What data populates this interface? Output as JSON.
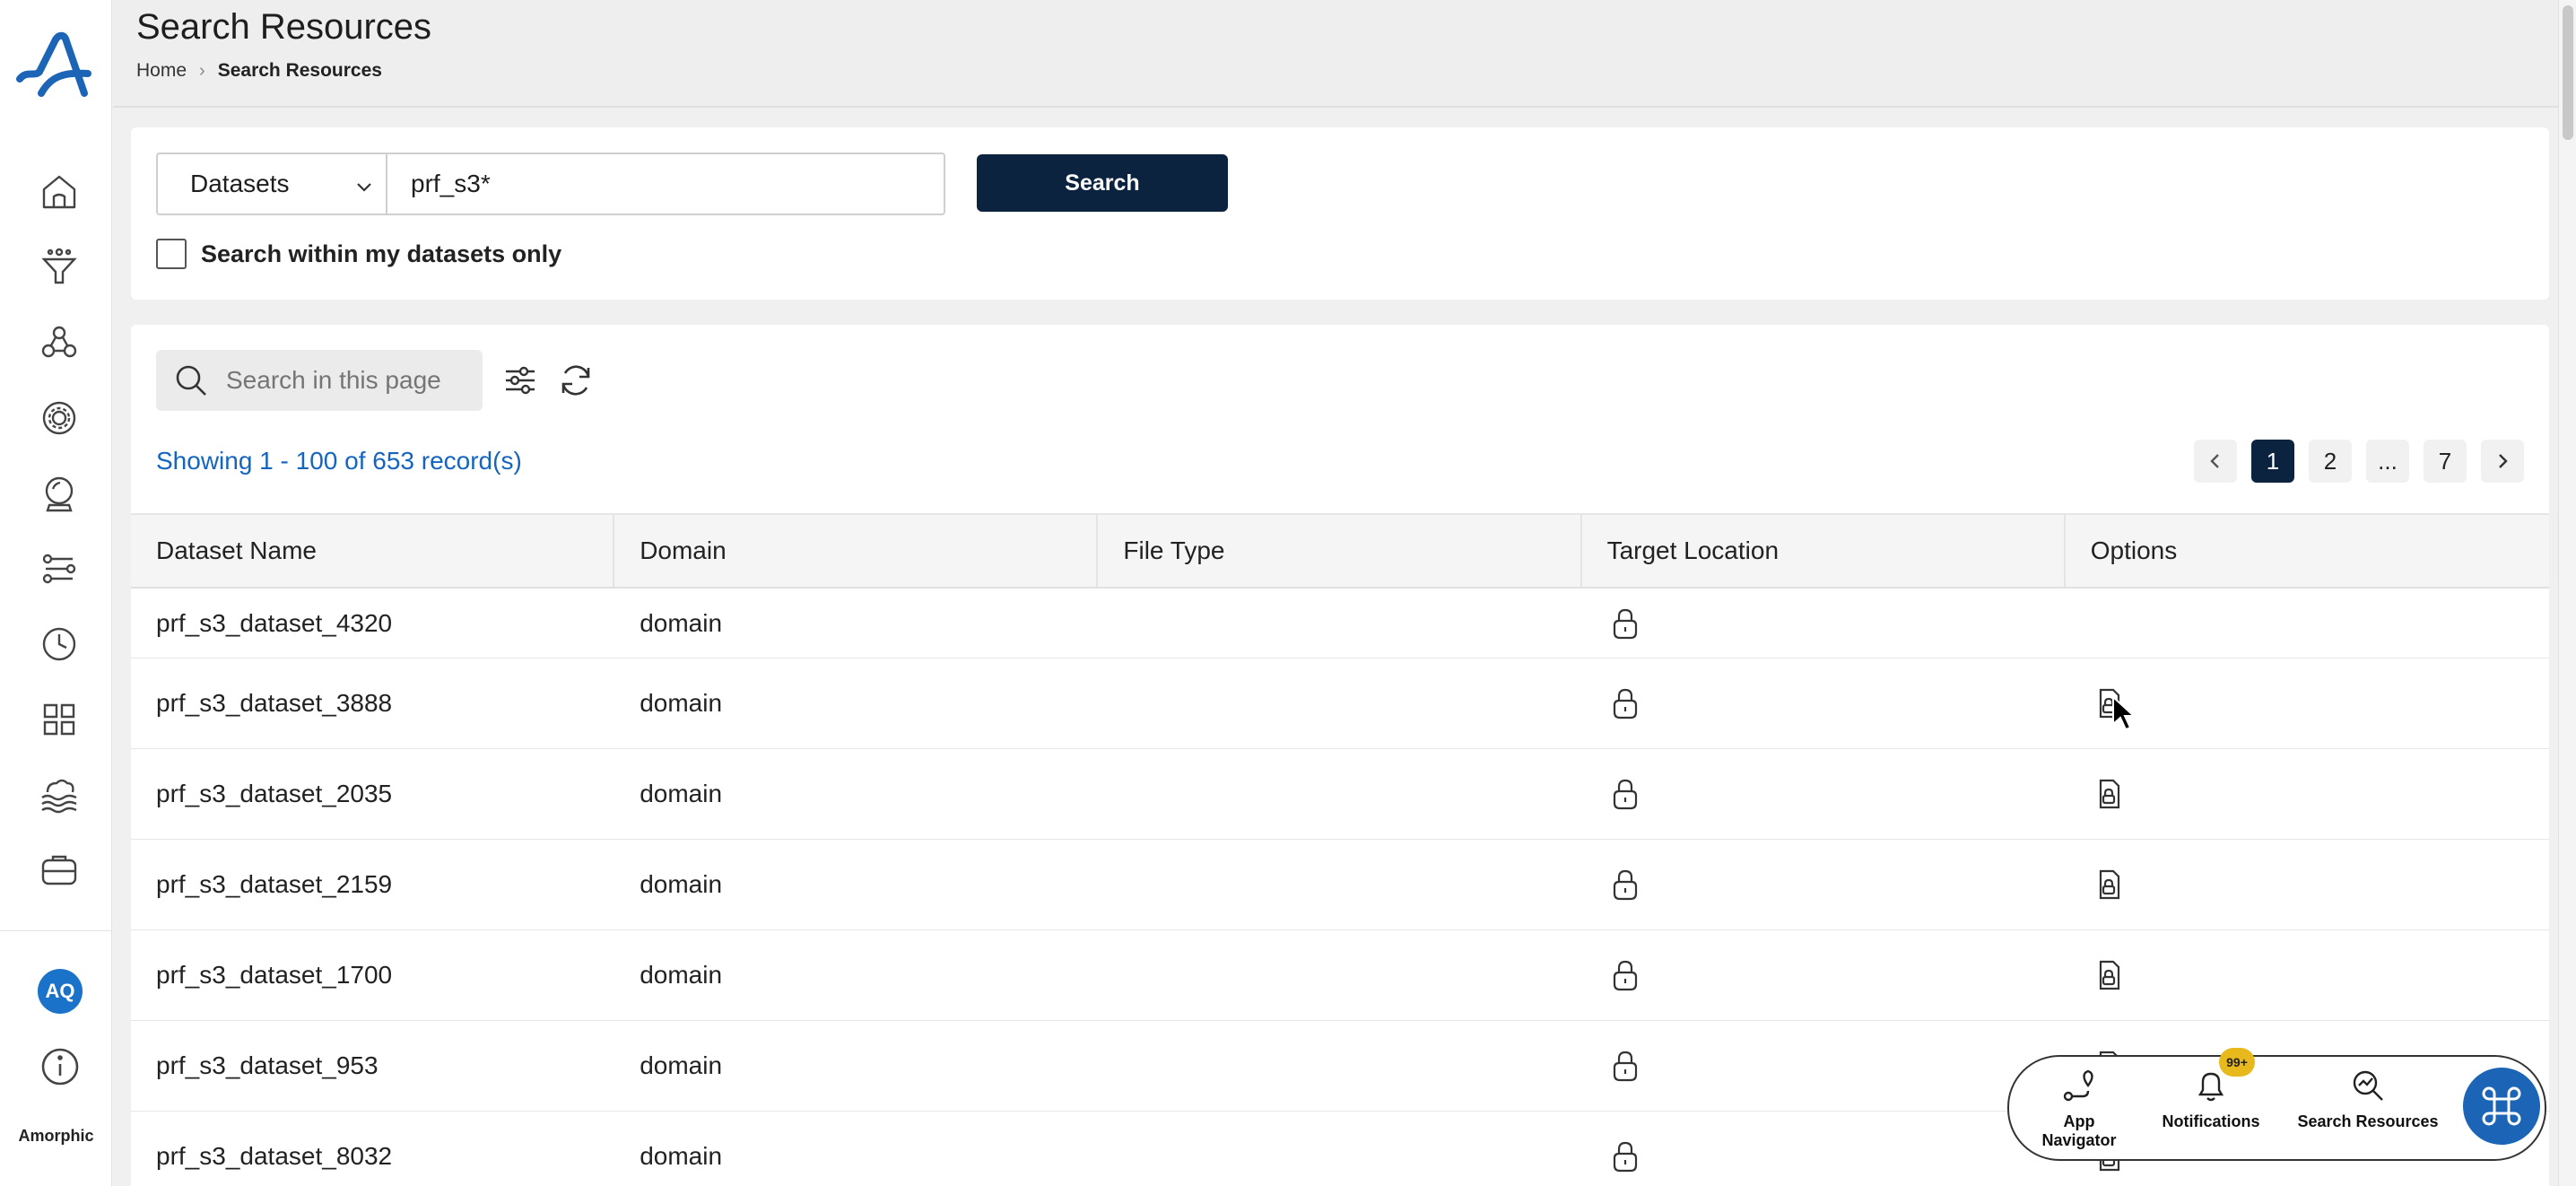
{
  "app": {
    "brand": "Amorphic",
    "user_initials": "AQ"
  },
  "header": {
    "title": "Search Resources",
    "breadcrumb": [
      "Home",
      "Search Resources"
    ]
  },
  "search": {
    "type_selected": "Datasets",
    "query": "prf_s3*",
    "button_label": "Search",
    "my_datasets_only_label": "Search within my datasets only",
    "my_datasets_only_checked": false
  },
  "results": {
    "page_search_placeholder": "Search in this page",
    "record_count_text": "Showing 1 - 100 of 653 record(s)",
    "pagination": {
      "pages": [
        "1",
        "2",
        "...",
        "7"
      ],
      "current": "1"
    },
    "columns": [
      "Dataset Name",
      "Domain",
      "File Type",
      "Target Location",
      "Options"
    ],
    "rows": [
      {
        "name": "prf_s3_dataset_4320",
        "domain": "domain",
        "file_type": "",
        "target_icon": "lock-icon",
        "has_option": false
      },
      {
        "name": "prf_s3_dataset_3888",
        "domain": "domain",
        "file_type": "",
        "target_icon": "lock-icon",
        "has_option": true
      },
      {
        "name": "prf_s3_dataset_2035",
        "domain": "domain",
        "file_type": "",
        "target_icon": "lock-icon",
        "has_option": true
      },
      {
        "name": "prf_s3_dataset_2159",
        "domain": "domain",
        "file_type": "",
        "target_icon": "lock-icon",
        "has_option": true
      },
      {
        "name": "prf_s3_dataset_1700",
        "domain": "domain",
        "file_type": "",
        "target_icon": "lock-icon",
        "has_option": true
      },
      {
        "name": "prf_s3_dataset_953",
        "domain": "domain",
        "file_type": "",
        "target_icon": "lock-icon",
        "has_option": true
      },
      {
        "name": "prf_s3_dataset_8032",
        "domain": "domain",
        "file_type": "",
        "target_icon": "lock-icon",
        "has_option": true
      }
    ]
  },
  "dock": {
    "items": [
      {
        "label": "App Navigator",
        "icon": "route-icon"
      },
      {
        "label": "Notifications",
        "icon": "bell-icon"
      },
      {
        "label": "Search Resources",
        "icon": "search-chart-icon"
      }
    ],
    "notification_badge": "99+"
  },
  "colors": {
    "primary_dark": "#0c2340",
    "accent_blue": "#1b64b6",
    "link_blue": "#1565c0",
    "badge": "#e8b91c"
  }
}
